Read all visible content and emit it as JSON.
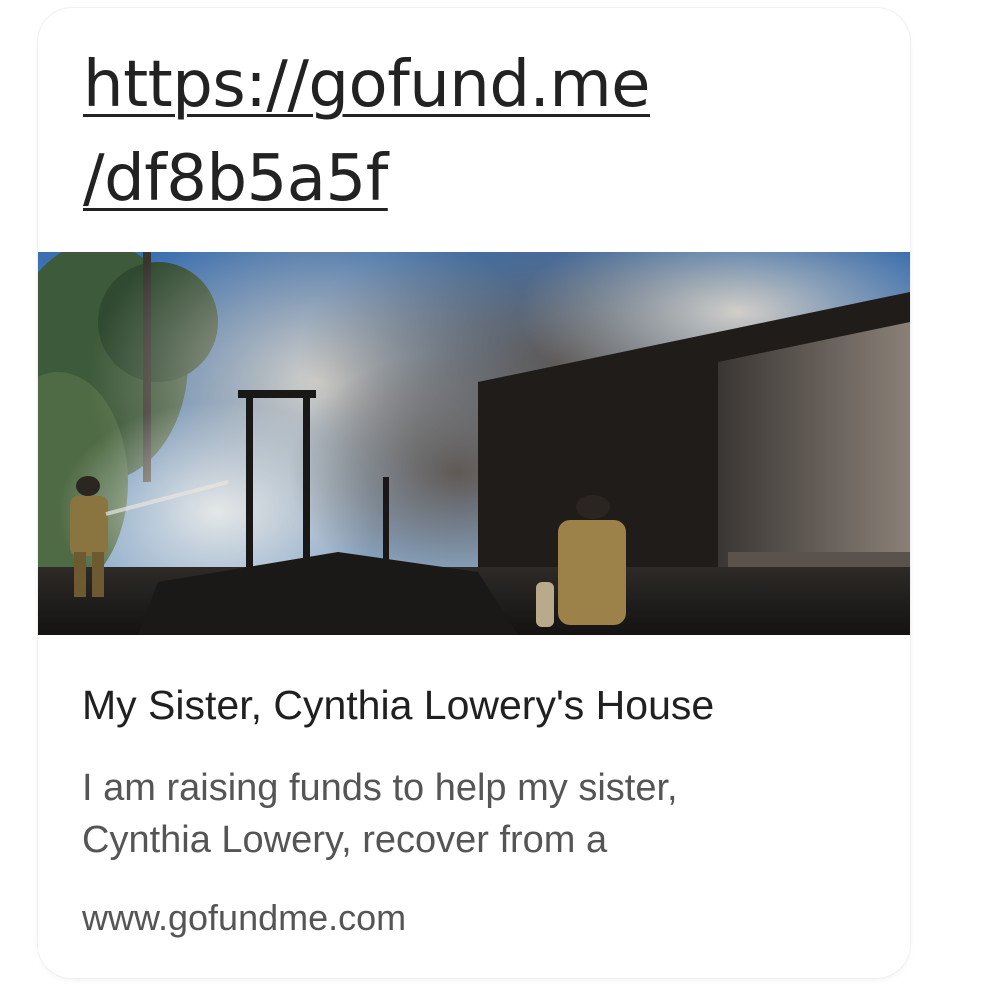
{
  "message": {
    "link": {
      "line1": "https://gofund.me",
      "line2": "/df8b5a5f"
    }
  },
  "preview": {
    "title": "My Sister, Cynthia Lowery's House",
    "description_line1": "I am raising funds to help my sister,",
    "description_line2": "Cynthia Lowery, recover from a",
    "domain": "www.gofundme.com"
  },
  "colors": {
    "text_primary": "#202020",
    "text_secondary": "#555555",
    "bubble_background": "#ffffff"
  }
}
